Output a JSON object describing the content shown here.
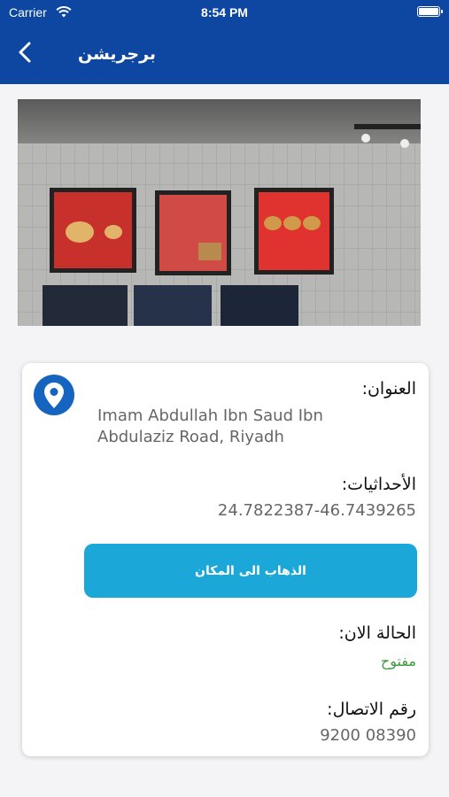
{
  "status_bar": {
    "carrier": "Carrier",
    "time": "8:54 PM"
  },
  "nav": {
    "title": "برجريشن",
    "back_icon": "chevron-left-icon"
  },
  "details": {
    "address_label": "العنوان:",
    "address_value": "Imam Abdullah Ibn Saud Ibn Abdulaziz Road, Riyadh",
    "coords_label": "الأحداثيات:",
    "coords_value": "24.7822387-46.7439265",
    "go_button": "الذهاب الى المكان",
    "status_label": "الحالة الان:",
    "status_value": "مفتوح",
    "phone_label": "رقم الاتصال:",
    "phone_value": "9200 08390"
  },
  "colors": {
    "header": "#0d47a1",
    "button": "#1ba8d8",
    "open": "#3a9a3a",
    "pin": "#1565c0"
  }
}
